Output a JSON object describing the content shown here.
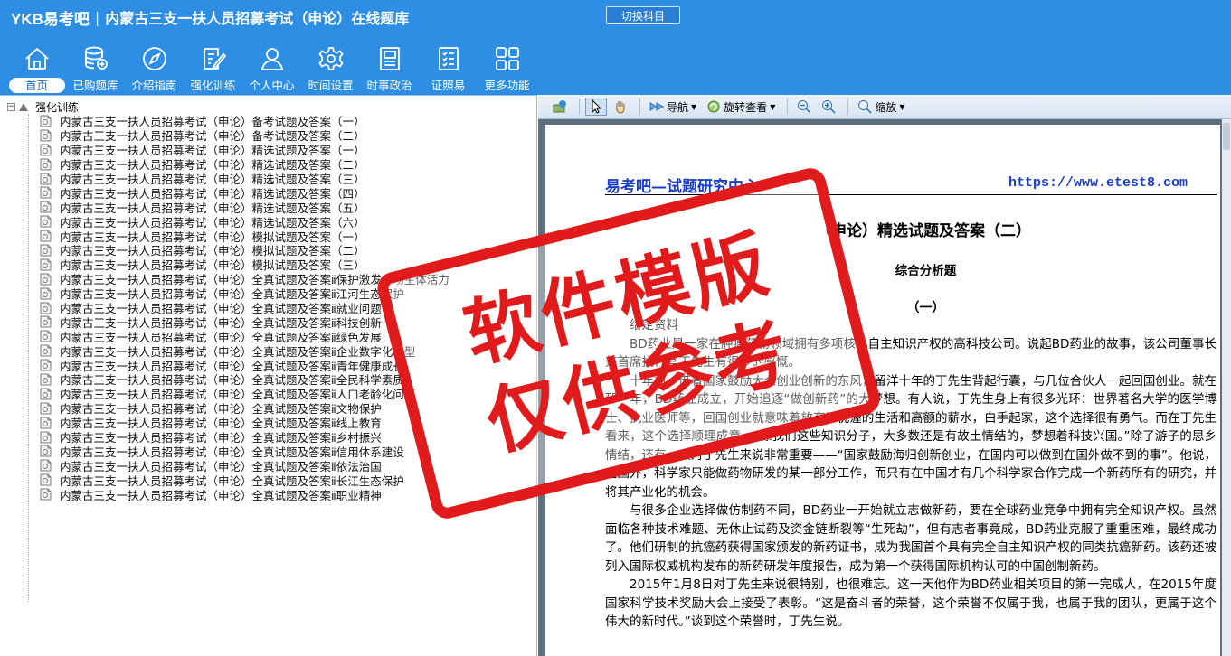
{
  "header": {
    "logo": "YKB易考吧",
    "title": "内蒙古三支一扶人员招募考试（申论）在线题库",
    "switch_label": "切换科目"
  },
  "toolbar": [
    {
      "label": "首页",
      "icon": "home-icon",
      "active": true
    },
    {
      "label": "已购题库",
      "icon": "database-icon"
    },
    {
      "label": "介绍指南",
      "icon": "compass-icon"
    },
    {
      "label": "强化训练",
      "icon": "edit-icon"
    },
    {
      "label": "个人中心",
      "icon": "user-icon"
    },
    {
      "label": "时间设置",
      "icon": "gear-icon"
    },
    {
      "label": "时事政治",
      "icon": "newspaper-icon"
    },
    {
      "label": "证照易",
      "icon": "checklist-icon"
    },
    {
      "label": "更多功能",
      "icon": "grid-icon"
    }
  ],
  "tree": {
    "expander": "−",
    "root": "强化训练",
    "items": [
      "内蒙古三支一扶人员招募考试（申论）备考试题及答案（一）",
      "内蒙古三支一扶人员招募考试（申论）备考试题及答案（二）",
      "内蒙古三支一扶人员招募考试（申论）精选试题及答案（一）",
      "内蒙古三支一扶人员招募考试（申论）精选试题及答案（二）",
      "内蒙古三支一扶人员招募考试（申论）精选试题及答案（三）",
      "内蒙古三支一扶人员招募考试（申论）精选试题及答案（四）",
      "内蒙古三支一扶人员招募考试（申论）精选试题及答案（五）",
      "内蒙古三支一扶人员招募考试（申论）精选试题及答案（六）",
      "内蒙古三支一扶人员招募考试（申论）模拟试题及答案（一）",
      "内蒙古三支一扶人员招募考试（申论）模拟试题及答案（二）",
      "内蒙古三支一扶人员招募考试（申论）模拟试题及答案（三）",
      "内蒙古三支一扶人员招募考试（申论）全真试题及答案ⅱ保护激发市场主体活力",
      "内蒙古三支一扶人员招募考试（申论）全真试题及答案ⅱ江河生态保护",
      "内蒙古三支一扶人员招募考试（申论）全真试题及答案ⅱ就业问题",
      "内蒙古三支一扶人员招募考试（申论）全真试题及答案ⅱ科技创新",
      "内蒙古三支一扶人员招募考试（申论）全真试题及答案ⅱ绿色发展",
      "内蒙古三支一扶人员招募考试（申论）全真试题及答案ⅱ企业数字化转型",
      "内蒙古三支一扶人员招募考试（申论）全真试题及答案ⅱ青年健康成长",
      "内蒙古三支一扶人员招募考试（申论）全真试题及答案ⅱ全民科学素质",
      "内蒙古三支一扶人员招募考试（申论）全真试题及答案ⅱ人口老龄化问题",
      "内蒙古三支一扶人员招募考试（申论）全真试题及答案ⅱ文物保护",
      "内蒙古三支一扶人员招募考试（申论）全真试题及答案ⅱ线上教育",
      "内蒙古三支一扶人员招募考试（申论）全真试题及答案ⅱ乡村振兴",
      "内蒙古三支一扶人员招募考试（申论）全真试题及答案ⅱ信用体系建设",
      "内蒙古三支一扶人员招募考试（申论）全真试题及答案ⅱ依法治国",
      "内蒙古三支一扶人员招募考试（申论）全真试题及答案ⅱ长江生态保护",
      "内蒙古三支一扶人员招募考试（申论）全真试题及答案ⅱ职业精神"
    ]
  },
  "viewer_toolbar": {
    "nav": "导航",
    "rotate": "旋转查看",
    "zoom": "缩放"
  },
  "document": {
    "header_left": "易考吧—试题研究中心",
    "header_right": "https://www.etest8.com",
    "title": "（申论）精选试题及答案（二）",
    "subtitle": "综合分析题",
    "section": "（一）",
    "label": "给定资料",
    "paragraphs": [
      "BD药业是一家在肿瘤药物领域拥有多项核心自主知识产权的高科技公司。说起BD药业的故事，该公司董事长兼首席执行官丁先生有很多的感慨。",
      "十年前，借着国家鼓励大众创业创新的东风，留洋十年的丁先生背起行囊，与几位合伙人一起回国创业。就在那一年，BD药业成立，开始追逐“做创新药”的大梦想。有人说，丁先生身上有很多光环：世界著名大学的医学博士、执业医师等，回国创业就意味着放弃了优渥的生活和高额的薪水，白手起家，这个选择很有勇气。而在丁先生看来，这个选择顺理成章。“像我们这些知识分子，大多数还是有故土情结的，梦想着科技兴国。”除了游子的思乡情结，还有一点对丁先生来说非常重要——“国家鼓励海归创新创业，在国内可以做到在国外做不到的事”。他说，在国外，科学家只能做药物研发的某一部分工作，而只有在中国才有几个科学家合作完成一个新药所有的研究，并将其产业化的机会。",
      "与很多企业选择做仿制药不同，BD药业一开始就立志做新药，要在全球药业竞争中拥有完全知识产权。虽然面临各种技术难题、无休止试药及资金链断裂等“生死劫”，但有志者事竟成，BD药业克服了重重困难，最终成功了。他们研制的抗癌药获得国家颁发的新药证书，成为我国首个具有完全自主知识产权的同类抗癌新药。该药还被列入国际权威机构发布的新药研发年度报告，成为第一个获得国际机构认可的中国创制新药。",
      "2015年1月8日对丁先生来说很特别，也很难忘。这一天他作为BD药业相关项目的第一完成人，在2015年度国家科学技术奖励大会上接受了表彰。“这是奋斗者的荣誉，这个荣誉不仅属于我，也属于我的团队，更属于这个伟大的新时代。”谈到这个荣誉时，丁先生说。"
    ]
  },
  "watermark": {
    "line1": "软件模版",
    "line2": "仅供参考"
  }
}
